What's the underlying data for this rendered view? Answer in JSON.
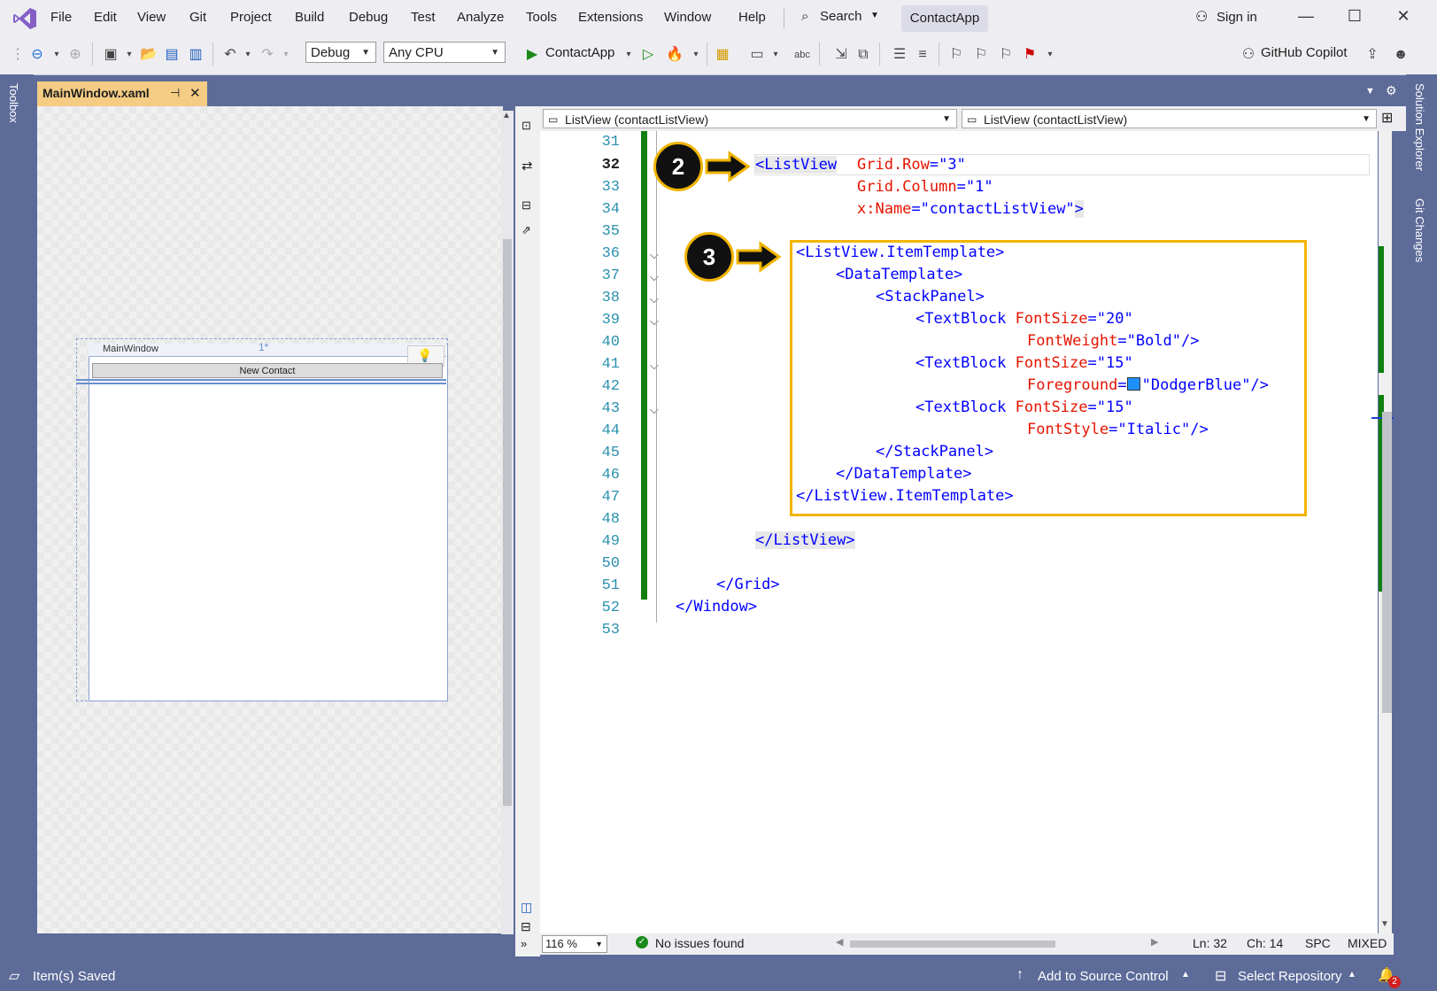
{
  "menubar": {
    "items": [
      "File",
      "Edit",
      "View",
      "Git",
      "Project",
      "Build",
      "Debug",
      "Test",
      "Analyze",
      "Tools",
      "Extensions",
      "Window",
      "Help"
    ],
    "search_label": "Search",
    "solution_name": "ContactApp",
    "sign_in": "Sign in"
  },
  "toolbar": {
    "config": "Debug",
    "platform": "Any CPU",
    "run_target": "ContactApp",
    "copilot": "GitHub Copilot"
  },
  "side": {
    "toolbox": "Toolbox",
    "solution_explorer": "Solution Explorer",
    "git_changes": "Git Changes"
  },
  "tab": {
    "title": "MainWindow.xaml",
    "pin": "⊣",
    "close": "✕"
  },
  "designer": {
    "window_title": "MainWindow",
    "button_label": "New Contact",
    "star": "1*"
  },
  "editor": {
    "nav_left": "ListView (contactListView)",
    "nav_right": "ListView (contactListView)",
    "line_numbers": [
      "31",
      "32",
      "33",
      "34",
      "35",
      "36",
      "37",
      "38",
      "39",
      "40",
      "41",
      "42",
      "43",
      "44",
      "45",
      "46",
      "47",
      "48",
      "49",
      "50",
      "51",
      "52",
      "53"
    ],
    "current_line": "32",
    "code": {
      "l32_open": "<ListView",
      "l32_attr": "Grid.Row",
      "l32_val": "\"3\"",
      "l33_attr": "Grid.Column",
      "l33_val": "\"1\"",
      "l34_attr": "x:Name",
      "l34_val": "\"contactListView\"",
      "l34_close": ">",
      "l36": "<ListView.ItemTemplate>",
      "l37": "<DataTemplate>",
      "l38": "<StackPanel>",
      "l39_tag": "<TextBlock",
      "l39_attr": "FontSize",
      "l39_val": "\"20\"",
      "l40_attr": "FontWeight",
      "l40_val": "\"Bold\"/>",
      "l41_tag": "<TextBlock",
      "l41_attr": "FontSize",
      "l41_val": "\"15\"",
      "l42_attr": "Foreground",
      "l42_val": "\"DodgerBlue\"/>",
      "l43_tag": "<TextBlock",
      "l43_attr": "FontSize",
      "l43_val": "\"15\"",
      "l44_attr": "FontStyle",
      "l44_val": "\"Italic\"/>",
      "l45": "</StackPanel>",
      "l46": "</DataTemplate>",
      "l47": "</ListView.ItemTemplate>",
      "l49": "</ListView>",
      "l51": "</Grid>",
      "l52": "</Window>"
    },
    "swatch_color": "#1e90ff",
    "callout_2": "2",
    "callout_3": "3"
  },
  "editor_status": {
    "zoom": "116 %",
    "issues": "No issues found",
    "line": "Ln: 32",
    "col": "Ch: 14",
    "spc": "SPC",
    "eol": "MIXED"
  },
  "statusbar": {
    "saved": "Item(s) Saved",
    "source_control": "Add to Source Control",
    "repo": "Select Repository",
    "notif_count": "2"
  },
  "colors": {
    "accent": "#f3b400",
    "frame": "#5d6b99",
    "change_bar": "#108010"
  }
}
